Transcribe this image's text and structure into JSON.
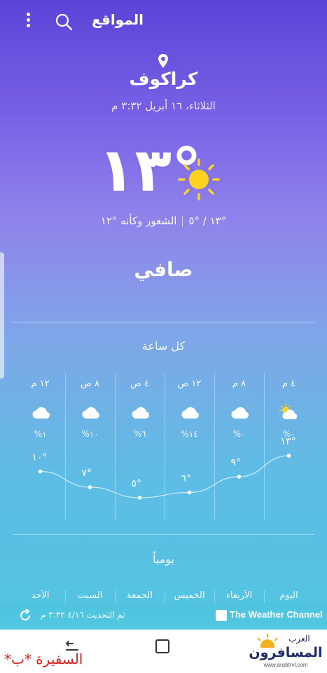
{
  "header": {
    "title": "المواقع",
    "search_icon": "search-icon",
    "more_icon": "more-vertical-icon"
  },
  "location": {
    "city": "كراكوف",
    "datetime": "الثلاثاء، ١٦ أبريل ٣:٣٢ م"
  },
  "current": {
    "temperature": "°١٣",
    "icon": "sun-icon",
    "high_low": "°١٣ / °٥",
    "feels_like": "الشعور وكأنه °١٢",
    "condition": "صافي"
  },
  "hourly": {
    "title": "كل ساعة",
    "items": [
      {
        "time": "٤ م",
        "icon": "partly-sunny-icon",
        "precip": "٠%",
        "temp": "°١٣",
        "value": 13
      },
      {
        "time": "٨ م",
        "icon": "cloud-icon",
        "precip": "٠%",
        "temp": "°٩",
        "value": 9
      },
      {
        "time": "١٢ ص",
        "icon": "cloud-icon",
        "precip": "١٤%",
        "temp": "°٦",
        "value": 6
      },
      {
        "time": "٤ ص",
        "icon": "cloud-icon",
        "precip": "٦%",
        "temp": "°٥",
        "value": 5
      },
      {
        "time": "٨ ص",
        "icon": "cloud-icon",
        "precip": "١٠%",
        "temp": "°٧",
        "value": 7
      },
      {
        "time": "١٢ م",
        "icon": "cloud-icon",
        "precip": "١%",
        "temp": "°١٠",
        "value": 10
      }
    ]
  },
  "daily": {
    "title": "يومياً",
    "days": [
      "اليوم",
      "الأربعاء",
      "الخميس",
      "الجمعة",
      "السبت",
      "الأحد"
    ]
  },
  "footer": {
    "provider": "The Weather Channel",
    "updated": "تم التحديث ٤/١٦ ٣:٣٢ م"
  },
  "overlay": {
    "watermark": "السفيرة *ب*",
    "brand_main": "المسافرون",
    "brand_top": "العرب",
    "brand_sub": "www.arabtrvl.com"
  }
}
